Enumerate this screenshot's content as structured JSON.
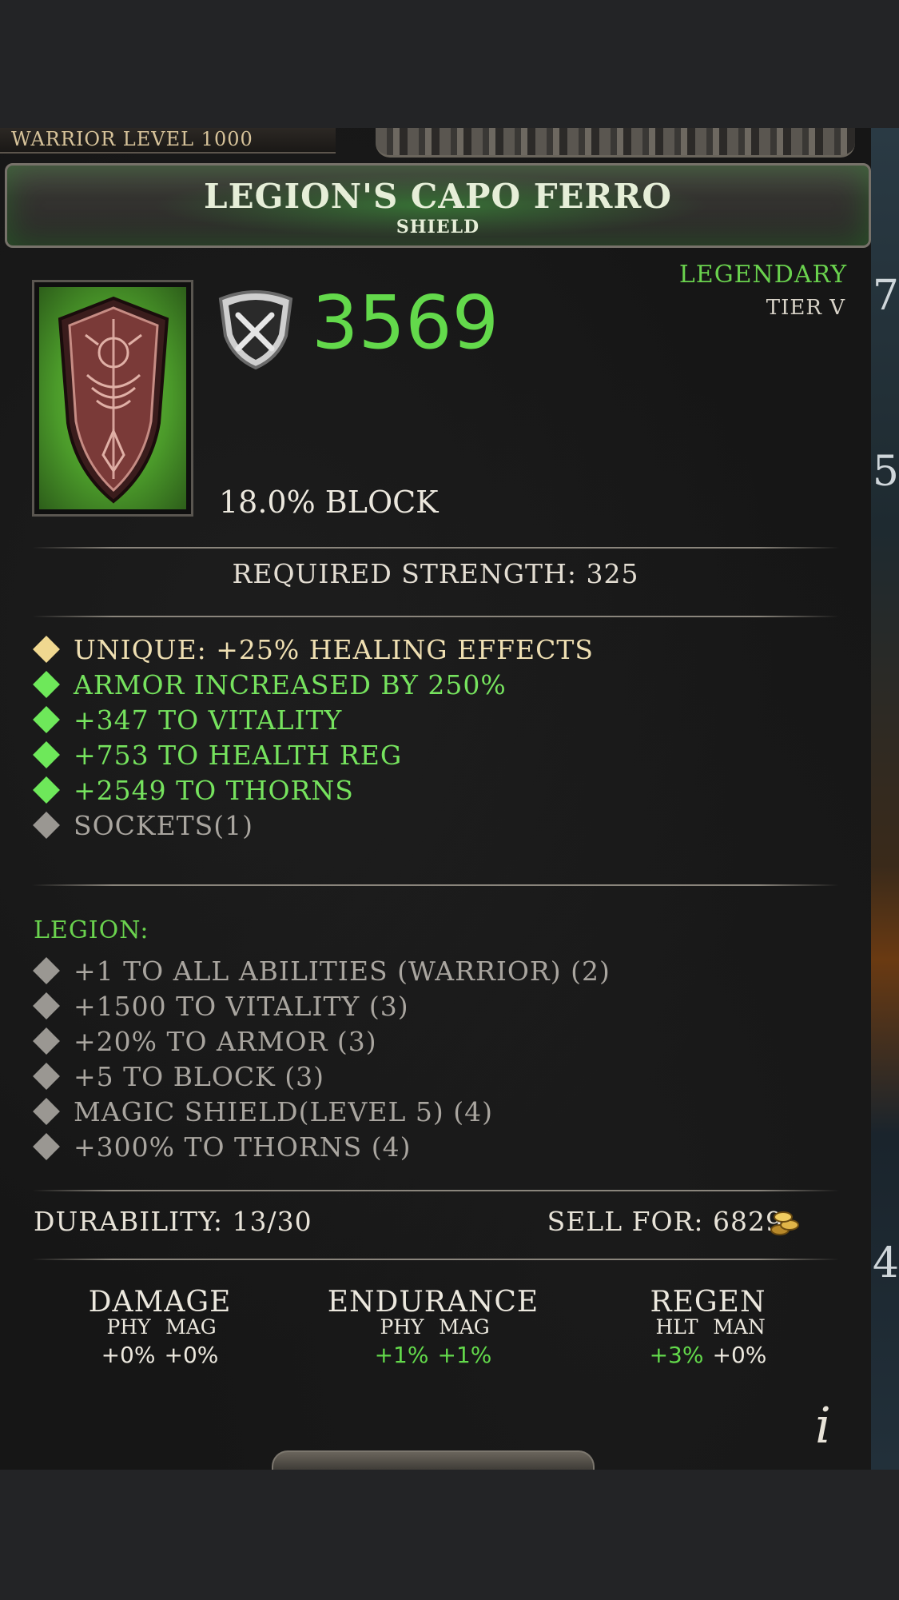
{
  "header": {
    "level_label": "WARRIOR LEVEL 1000",
    "item_name": "LEGION'S CAPO FERRO",
    "item_type": "SHIELD"
  },
  "item": {
    "armor": "3569",
    "rarity": "LEGENDARY",
    "tier": "TIER V",
    "block": "18.0% BLOCK",
    "requirement": "REQUIRED STRENGTH: 325",
    "rarity_color": "#6ad24e"
  },
  "affixes": [
    {
      "text": "UNIQUE: +25% HEALING EFFECTS",
      "color": "gold"
    },
    {
      "text": "ARMOR INCREASED BY 250%",
      "color": "green"
    },
    {
      "text": "+347 TO VITALITY",
      "color": "green"
    },
    {
      "text": "+753 TO HEALTH REG",
      "color": "green"
    },
    {
      "text": "+2549 TO THORNS",
      "color": "green"
    },
    {
      "text": "SOCKETS(1)",
      "color": "grey"
    }
  ],
  "set": {
    "name": "LEGION:",
    "bonuses": [
      "+1 TO ALL ABILITIES (WARRIOR) (2)",
      "+1500 TO VITALITY (3)",
      "+20% TO ARMOR (3)",
      "+5 TO BLOCK (3)",
      "MAGIC SHIELD(LEVEL 5) (4)",
      "+300% TO THORNS (4)"
    ]
  },
  "footer": {
    "durability": "DURABILITY: 13/30",
    "sell": "SELL FOR: 6829"
  },
  "stats": {
    "damage": {
      "title": "DAMAGE",
      "sub1": "PHY",
      "sub2": "MAG",
      "val1": "+0%",
      "val2": "+0%"
    },
    "endurance": {
      "title": "ENDURANCE",
      "sub1": "PHY",
      "sub2": "MAG",
      "val1": "+1%",
      "val2": "+1%"
    },
    "regen": {
      "title": "REGEN",
      "sub1": "HLT",
      "sub2": "MAN",
      "val1": "+3%",
      "val2": "+0%"
    }
  },
  "side_strip": {
    "digits": [
      "7",
      "5",
      "4"
    ]
  },
  "icons": {
    "info": "i"
  }
}
